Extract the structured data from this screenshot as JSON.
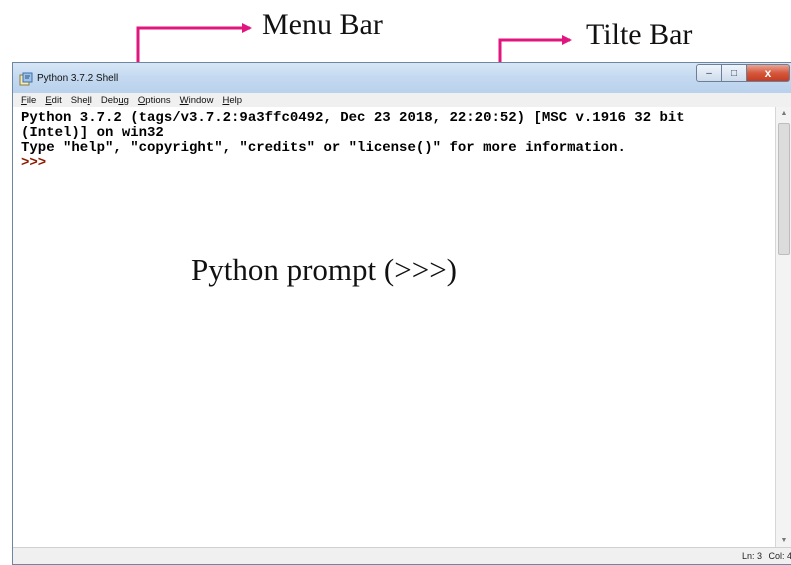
{
  "annotations": {
    "menu_bar": "Menu Bar",
    "title_bar": "Tilte Bar",
    "prompt": "Python prompt (>>>)"
  },
  "window": {
    "title": "Python 3.7.2 Shell",
    "controls": {
      "minimize": "–",
      "maximize": "□",
      "close": "x"
    }
  },
  "menu": [
    {
      "mnemonic": "F",
      "rest": "ile"
    },
    {
      "mnemonic": "E",
      "rest": "dit"
    },
    {
      "prefix": "She",
      "mnemonic": "l",
      "rest": "l"
    },
    {
      "prefix": "Deb",
      "mnemonic": "u",
      "rest": "g"
    },
    {
      "mnemonic": "O",
      "rest": "ptions"
    },
    {
      "mnemonic": "W",
      "rest": "indow"
    },
    {
      "mnemonic": "H",
      "rest": "elp"
    }
  ],
  "shell": {
    "line1": "Python 3.7.2 (tags/v3.7.2:9a3ffc0492, Dec 23 2018, 22:20:52) [MSC v.1916 32 bit",
    "line2": "(Intel)] on win32",
    "line3": "Type \"help\", \"copyright\", \"credits\" or \"license()\" for more information.",
    "prompt": ">>>"
  },
  "status": {
    "ln": "Ln: 3",
    "col": "Col: 4"
  },
  "colors": {
    "arrow": "#e0157e",
    "prompt": "#8b1a00",
    "titlebar": "#c5daf1"
  },
  "icons": {
    "app": "idle-icon",
    "annotation_arrows": "arrow-icon"
  }
}
